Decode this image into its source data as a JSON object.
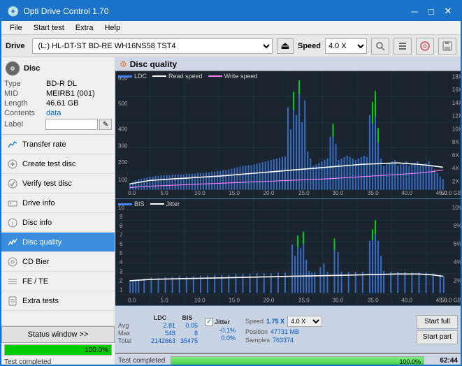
{
  "window": {
    "title": "Opti Drive Control 1.70",
    "minimize": "─",
    "maximize": "□",
    "close": "✕"
  },
  "menubar": {
    "items": [
      "File",
      "Start test",
      "Extra",
      "Help"
    ]
  },
  "drivebar": {
    "label": "Drive",
    "drive_value": "(L:)  HL-DT-ST BD-RE  WH16NS58 TST4",
    "speed_label": "Speed",
    "speed_value": "4.0 X",
    "eject_icon": "⏏"
  },
  "disc": {
    "title": "Disc",
    "type_label": "Type",
    "type_value": "BD-R DL",
    "mid_label": "MID",
    "mid_value": "MEIRB1 (001)",
    "length_label": "Length",
    "length_value": "46.61 GB",
    "contents_label": "Contents",
    "contents_value": "data",
    "label_label": "Label",
    "label_value": ""
  },
  "nav": {
    "items": [
      {
        "id": "transfer-rate",
        "label": "Transfer rate",
        "active": false
      },
      {
        "id": "create-test-disc",
        "label": "Create test disc",
        "active": false
      },
      {
        "id": "verify-test-disc",
        "label": "Verify test disc",
        "active": false
      },
      {
        "id": "drive-info",
        "label": "Drive info",
        "active": false
      },
      {
        "id": "disc-info",
        "label": "Disc info",
        "active": false
      },
      {
        "id": "disc-quality",
        "label": "Disc quality",
        "active": true
      },
      {
        "id": "cd-bier",
        "label": "CD Bier",
        "active": false
      },
      {
        "id": "fe-te",
        "label": "FE / TE",
        "active": false
      },
      {
        "id": "extra-tests",
        "label": "Extra tests",
        "active": false
      }
    ]
  },
  "status_window_btn": "Status window >>",
  "progress": {
    "value": 100,
    "text": "100.0%"
  },
  "status_text": "Test completed",
  "time": "62:44",
  "disc_quality": {
    "title": "Disc quality",
    "legend": [
      {
        "label": "LDC",
        "color": "#0066ff"
      },
      {
        "label": "Read speed",
        "color": "#ffffff"
      },
      {
        "label": "Write speed",
        "color": "#ff80ff"
      }
    ],
    "legend2": [
      {
        "label": "BIS",
        "color": "#0066ff"
      },
      {
        "label": "Jitter",
        "color": "#ffffff"
      }
    ]
  },
  "stats": {
    "headers": [
      "LDC",
      "BIS",
      "",
      "Jitter",
      "Speed",
      ""
    ],
    "avg_label": "Avg",
    "avg_ldc": "2.81",
    "avg_bis": "0.05",
    "avg_jitter": "-0.1%",
    "max_label": "Max",
    "max_ldc": "548",
    "max_bis": "8",
    "max_jitter": "0.0%",
    "total_label": "Total",
    "total_ldc": "2142663",
    "total_bis": "35475",
    "speed_label": "Speed",
    "speed_value": "1.75 X",
    "speed_select": "4.0 X",
    "position_label": "Position",
    "position_value": "47731 MB",
    "samples_label": "Samples",
    "samples_value": "763374"
  },
  "buttons": {
    "start_full": "Start full",
    "start_part": "Start part"
  }
}
